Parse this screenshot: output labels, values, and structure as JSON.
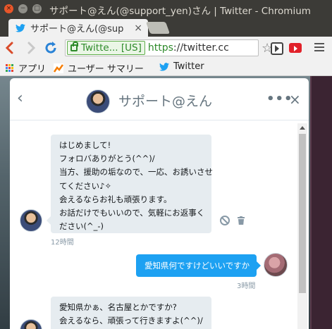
{
  "window": {
    "title": "サポート@えん(@support_yen)さん | Twitter - Chromium",
    "close": "×",
    "minimize": "−",
    "maximize": "□"
  },
  "tab": {
    "title": "サポート@えん(@sup",
    "close": "×"
  },
  "omnibox": {
    "secure_label": "Twitte... [US]",
    "url_scheme": "https",
    "url_rest": "://twitter.cc",
    "star": "☆"
  },
  "bookmarks": {
    "apps": "アプリ",
    "summary": "ユーザー サマリー",
    "twitter": "Twitter"
  },
  "conversation": {
    "title": "サポート@えん",
    "back": "‹",
    "more": "•••",
    "close": "×",
    "messages": [
      {
        "direction": "in",
        "lines": [
          "はじめまして!",
          "フォロバありがとう(^^)/",
          "当方、援助の垢なので、一応、お誘いさせ",
          "てください♪✧",
          "会えるならお礼も頑張ります。",
          "お話だけでもいいので、気軽にお返事く",
          "ださい(^_-)"
        ],
        "time": "12時間"
      },
      {
        "direction": "out",
        "text": "愛知県何ですけどいいですか",
        "time": "3時間"
      },
      {
        "direction": "in",
        "lines": [
          "愛知県かぁ、名古屋とかですか?",
          "会えるなら、頑張って行きますよ(^^)/"
        ]
      }
    ]
  },
  "colors": {
    "twitter_blue": "#1da1f2",
    "bubble_gray": "#e6ecf0",
    "secure_green": "#2e8a2a",
    "ubuntu_dark": "#3c3b37"
  }
}
